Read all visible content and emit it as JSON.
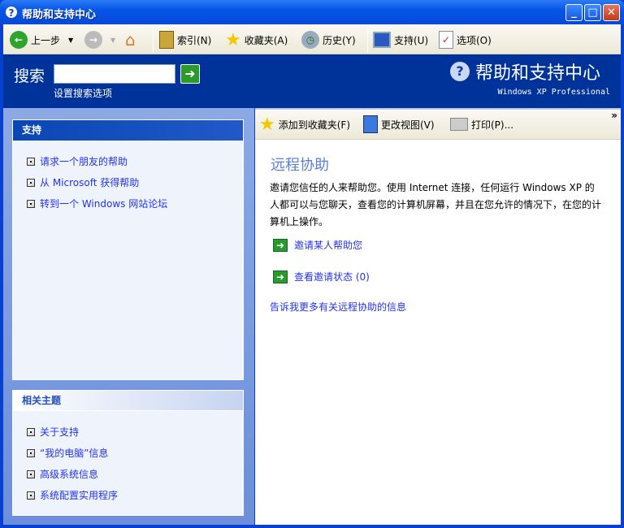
{
  "window": {
    "title": "帮助和支持中心"
  },
  "toolbar": {
    "back": "上一步",
    "index": "索引(N)",
    "favorites": "收藏夹(A)",
    "history": "历史(Y)",
    "support": "支持(U)",
    "options": "选项(O)"
  },
  "search": {
    "label": "搜索",
    "value": "",
    "options_link": "设置搜索选项"
  },
  "brand": {
    "title": "帮助和支持中心",
    "subtitle": "Windows XP Professional"
  },
  "sidebar": {
    "support": {
      "title": "支持",
      "items": [
        "请求一个朋友的帮助",
        "从 Microsoft 获得帮助",
        "转到一个 Windows 网站论坛"
      ]
    },
    "related": {
      "title": "相关主题",
      "items": [
        "关于支持",
        "“我的电脑”信息",
        "高级系统信息",
        "系统配置实用程序"
      ]
    }
  },
  "content_toolbar": {
    "add_favorites": "添加到收藏夹(F)",
    "change_view": "更改视图(V)",
    "print": "打印(P)...",
    "more": "»"
  },
  "content": {
    "title": "远程协助",
    "body": "邀请您信任的人来帮助您。使用 Internet 连接，任何运行 Windows XP 的人都可以与您聊天，查看您的计算机屏幕，并且在您允许的情况下，在您的计算机上操作。",
    "tasks": [
      "邀请某人帮助您",
      "查看邀请状态 (0)"
    ],
    "more_link": "告诉我更多有关远程协助的信息"
  }
}
